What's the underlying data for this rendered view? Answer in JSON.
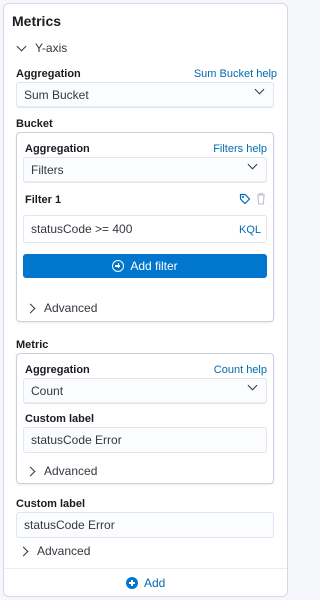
{
  "panel": {
    "title": "Metrics",
    "yaxis_label": "Y-axis",
    "aggregation_label": "Aggregation",
    "aggregation_help": "Sum Bucket help",
    "aggregation_value": "Sum Bucket",
    "bucket_label": "Bucket",
    "bucket": {
      "aggregation_label": "Aggregation",
      "aggregation_help": "Filters help",
      "aggregation_value": "Filters",
      "filter_label": "Filter 1",
      "filter_value": "statusCode >= 400",
      "kql_label": "KQL",
      "add_filter_label": "Add filter",
      "advanced_label": "Advanced"
    },
    "metric_label": "Metric",
    "metric": {
      "aggregation_label": "Aggregation",
      "aggregation_help": "Count help",
      "aggregation_value": "Count",
      "custom_label_label": "Custom label",
      "custom_label_value": "statusCode Error",
      "advanced_label": "Advanced"
    },
    "custom_label_label": "Custom label",
    "custom_label_value": "statusCode Error",
    "advanced_label": "Advanced",
    "add_label": "Add"
  },
  "colors": {
    "accent": "#0077cc",
    "link": "#006bb4",
    "border": "#d3dae6"
  },
  "icons": [
    "chevron-down-icon",
    "chevron-right-icon",
    "tag-icon",
    "trash-icon",
    "plus-circle-icon"
  ]
}
